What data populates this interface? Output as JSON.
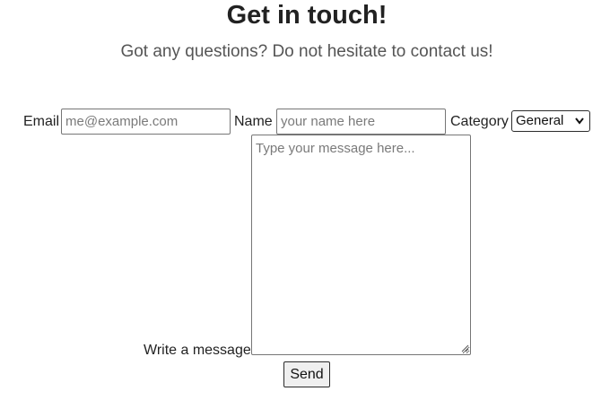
{
  "header": {
    "title": "Get in touch!",
    "subtitle": "Got any questions? Do not hesitate to contact us!"
  },
  "form": {
    "email": {
      "label": "Email",
      "placeholder": "me@example.com",
      "value": ""
    },
    "name": {
      "label": "Name",
      "placeholder": "your name here",
      "value": ""
    },
    "category": {
      "label": "Category",
      "selected": "General",
      "icon": "chevron-down-icon"
    },
    "message": {
      "label": "Write a message",
      "placeholder": "Type your message here...",
      "value": ""
    },
    "send_label": "Send"
  }
}
